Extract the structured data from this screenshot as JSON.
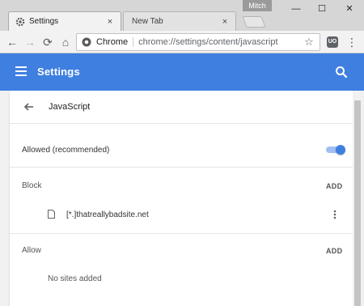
{
  "window": {
    "profile_name": "Mitch",
    "minimize_glyph": "—",
    "maximize_glyph": "☐",
    "close_glyph": "✕"
  },
  "tabs": [
    {
      "title": "Settings",
      "icon": "gear-icon",
      "active": true,
      "close_glyph": "×"
    },
    {
      "title": "New Tab",
      "active": false,
      "close_glyph": "×"
    }
  ],
  "toolbar": {
    "back_glyph": "←",
    "forward_glyph": "→",
    "reload_glyph": "⟳",
    "home_glyph": "⌂",
    "omnibox_chip": "Chrome",
    "omnibox_url": "chrome://settings/content/javascript",
    "star_glyph": "☆",
    "extension_label": "UO",
    "menu_glyph": "⋮"
  },
  "appbar": {
    "title": "Settings",
    "color": "#3f7fe0"
  },
  "page": {
    "title": "JavaScript",
    "allowed_label": "Allowed (recommended)",
    "allowed_enabled": true,
    "block_section": {
      "label": "Block",
      "add_label": "ADD",
      "sites": [
        {
          "pattern": "[*.]thatreallybadsite.net"
        }
      ]
    },
    "allow_section": {
      "label": "Allow",
      "add_label": "ADD",
      "empty_text": "No sites added"
    }
  }
}
